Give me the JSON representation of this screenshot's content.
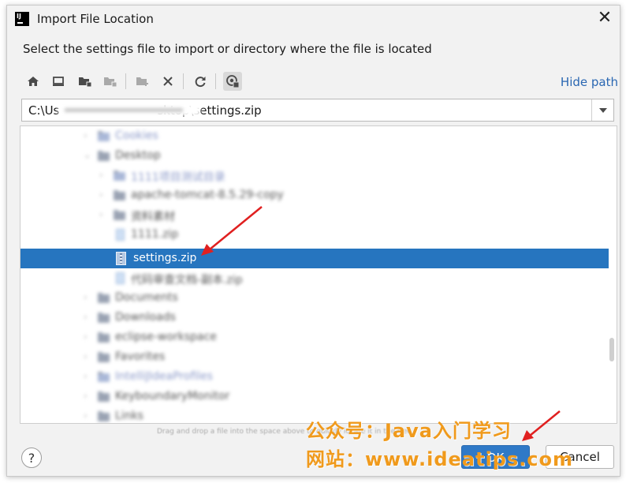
{
  "window": {
    "title": "Import File Location",
    "close_glyph": "✕",
    "app_icon_text": "IJ"
  },
  "instruction": "Select the settings file to import or directory where the file is located",
  "toolbar": {
    "buttons": [
      "home-icon",
      "desktop-icon",
      "project-folder-icon",
      "module-folder-icon",
      "new-folder-icon",
      "delete-icon",
      "refresh-icon",
      "show-hidden-icon"
    ],
    "hide_path_label": "Hide path"
  },
  "path": {
    "value": "C:\\Us                          sktop\\settings.zip"
  },
  "tree": {
    "rows": [
      {
        "label": "Cookies",
        "type": "folder",
        "blurred": true
      },
      {
        "label": "Desktop",
        "type": "folder",
        "blurred": true
      },
      {
        "label": "1111项目测试目录",
        "type": "folder",
        "blurred": true
      },
      {
        "label": "apache-tomcat-8.5.29-copy",
        "type": "folder",
        "blurred": true
      },
      {
        "label": "资料素材",
        "type": "folder",
        "blurred": true
      },
      {
        "label": "1111.zip",
        "type": "file",
        "blurred": true
      },
      {
        "label": "settings.zip",
        "type": "zip",
        "blurred": false,
        "selected": true
      },
      {
        "label": "代码审查文档-副本.zip",
        "type": "file",
        "blurred": true
      },
      {
        "label": "Documents",
        "type": "folder",
        "blurred": true
      },
      {
        "label": "Downloads",
        "type": "folder",
        "blurred": true
      },
      {
        "label": "eclipse-workspace",
        "type": "folder",
        "blurred": true
      },
      {
        "label": "Favorites",
        "type": "folder",
        "blurred": true
      },
      {
        "label": "IntelliJIdeaProfiles",
        "type": "folder",
        "blurred": true
      },
      {
        "label": "KeyboundaryMonitor",
        "type": "folder",
        "blurred": true
      },
      {
        "label": "Links",
        "type": "folder",
        "blurred": true
      }
    ],
    "drag_hint": "Drag and drop a file into the space above to quickly locate it in the tree"
  },
  "buttons": {
    "help": "?",
    "ok": "OK",
    "cancel": "Cancel"
  },
  "watermark": {
    "line1": "公众号：Java入门学习",
    "line2": "网站：www.ideatips.com"
  },
  "colors": {
    "accent": "#2675bf",
    "link": "#2a67b2",
    "watermark": "#f09a1c",
    "arrow": "#e02020"
  }
}
